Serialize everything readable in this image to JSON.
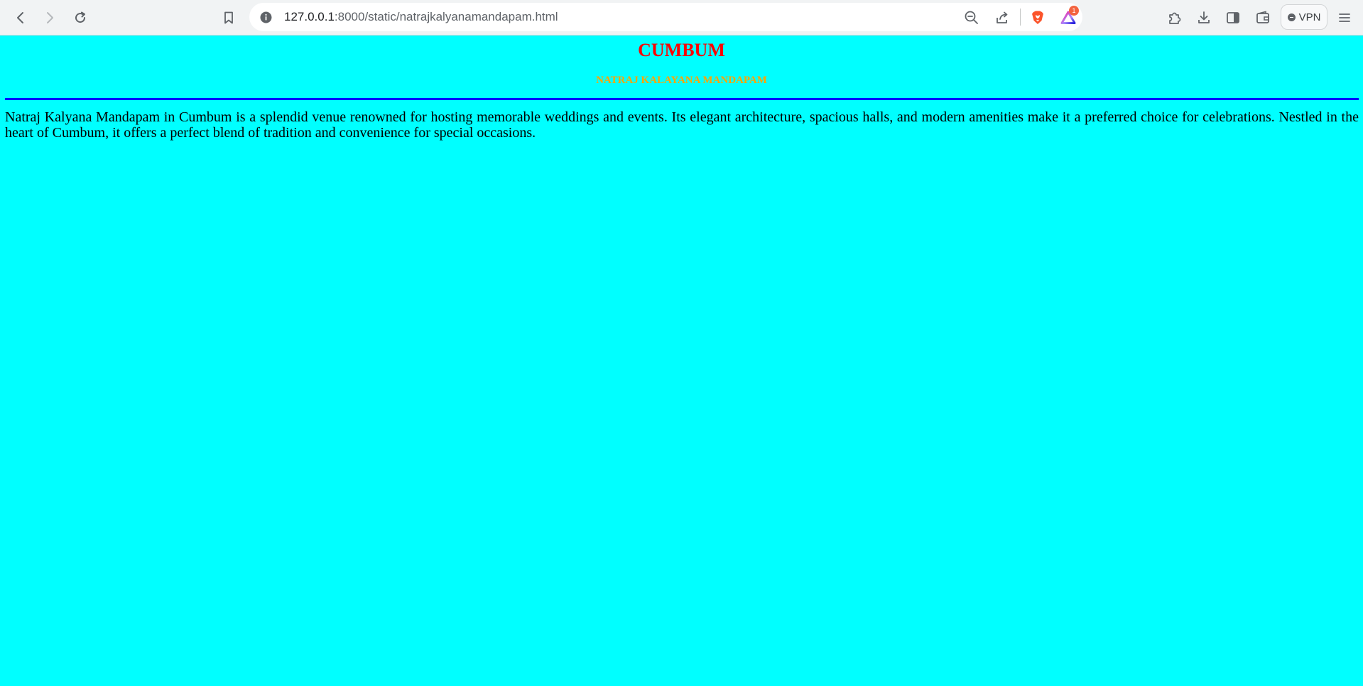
{
  "browser": {
    "url_host": "127.0.0.1",
    "url_path": ":8000/static/natrajkalyanamandapam.html",
    "vpn_label": "VPN",
    "rewards_badge": "1"
  },
  "page": {
    "title": "CUMBUM",
    "subtitle": "NATRAJ KALAYANA MANDAPAM",
    "description": "Natraj Kalyana Mandapam in Cumbum is a splendid venue renowned for hosting memorable weddings and events. Its elegant architecture, spacious halls, and modern amenities make it a preferred choice for celebrations. Nestled in the heart of Cumbum, it offers a perfect blend of tradition and convenience for special occasions."
  },
  "colors": {
    "page_background": "#00ffff",
    "title": "#ff0000",
    "subtitle": "#ffa500",
    "rule": "#0000ff",
    "text": "#000000"
  },
  "icons": [
    "back-arrow-icon",
    "forward-arrow-icon",
    "reload-icon",
    "bookmark-icon",
    "site-info-icon",
    "zoom-out-icon",
    "share-icon",
    "brave-shields-icon",
    "brave-rewards-icon",
    "extensions-icon",
    "downloads-icon",
    "sidebar-icon",
    "wallet-icon",
    "menu-icon"
  ]
}
